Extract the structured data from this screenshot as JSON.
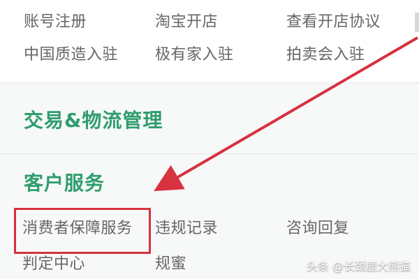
{
  "merchant_links": {
    "row1": [
      "账号注册",
      "淘宝开店",
      "查看开店协议"
    ],
    "row2": [
      "中国质造入驻",
      "极有家入驻",
      "拍卖会入驻"
    ]
  },
  "sections": {
    "trade_logistics": "交易&物流管理",
    "customer_service": "客户服务"
  },
  "customer_service_links": {
    "row1": [
      "消费者保障服务",
      "违规记录",
      "咨询回复"
    ],
    "row2": [
      "判定中心",
      "规蜜"
    ]
  },
  "annotations": {
    "arrow_color": "#d6323f",
    "highlight_color": "#d6323f"
  },
  "watermark": "头条 @长颈鹿大熊猫",
  "icons": {
    "arrow": "red-arrow-icon"
  }
}
